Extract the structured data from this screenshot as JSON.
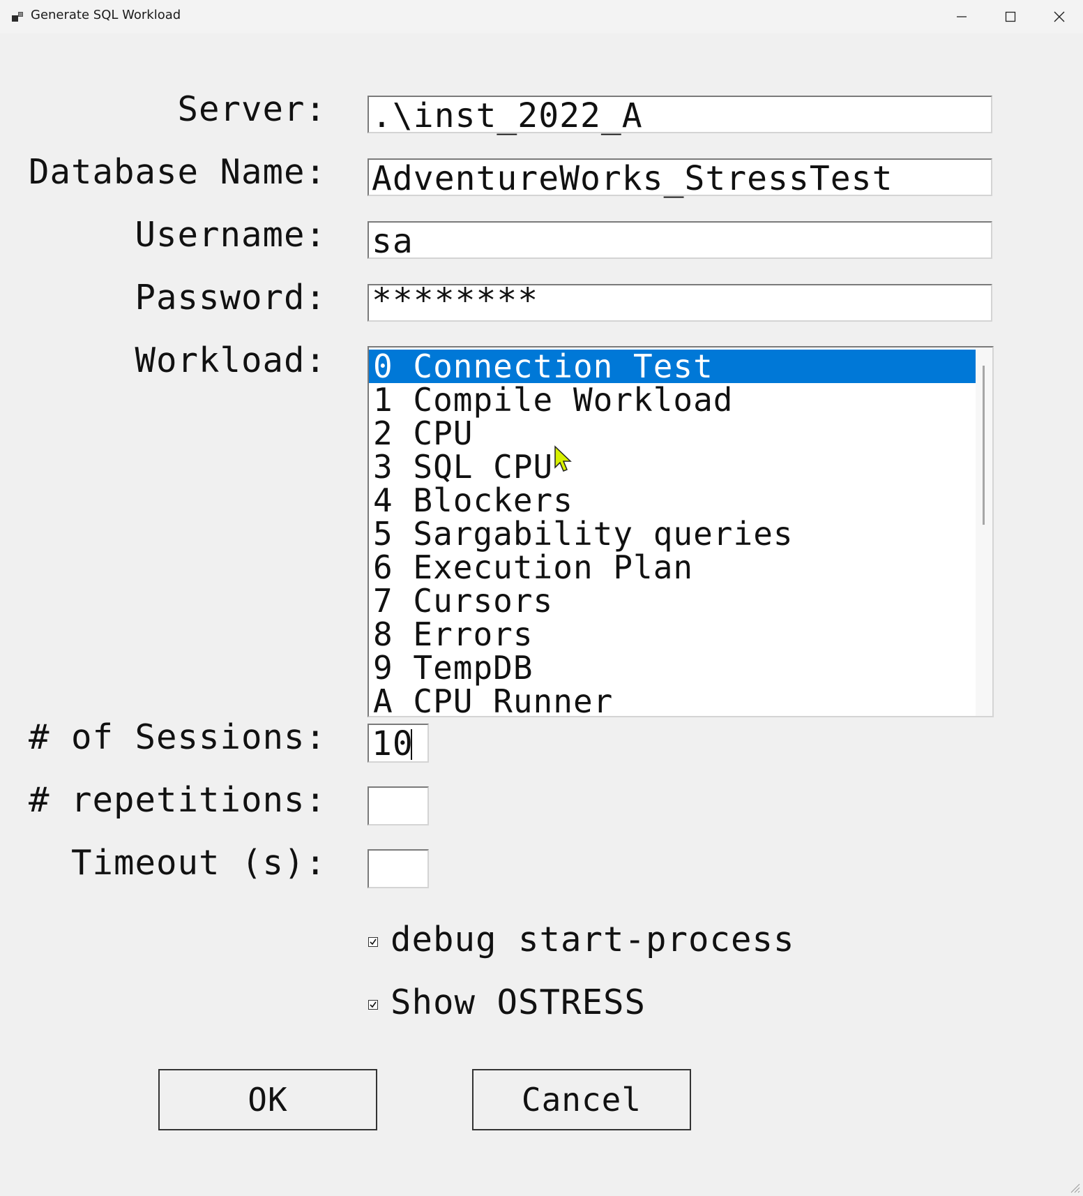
{
  "window": {
    "title": "Generate SQL Workload",
    "app_icon": "app-window-icon",
    "controls": [
      "minimize-icon",
      "maximize-icon",
      "close-icon"
    ]
  },
  "form": {
    "server": {
      "label": "Server:",
      "value": ".\\inst_2022_A"
    },
    "database": {
      "label": "Database Name:",
      "value": "AdventureWorks_StressTest"
    },
    "username": {
      "label": "Username:",
      "value": "sa"
    },
    "password": {
      "label": "Password:",
      "value": "********"
    },
    "workload": {
      "label": "Workload:",
      "selected_index": 0,
      "items": [
        "0 Connection Test",
        "1 Compile Workload",
        "2 CPU",
        "3 SQL CPU",
        "4 Blockers",
        "5 Sargability queries",
        "6 Execution Plan",
        "7 Cursors",
        "8 Errors",
        "9 TempDB",
        "A CPU Runner"
      ]
    },
    "sessions": {
      "label": "# of Sessions:",
      "value": "10"
    },
    "repetitions": {
      "label": "# repetitions:",
      "value": ""
    },
    "timeout": {
      "label": "Timeout (s):",
      "value": ""
    },
    "debug_checkbox": {
      "label": "debug start-process",
      "checked": true
    },
    "ostress_checkbox": {
      "label": "Show OSTRESS",
      "checked": true
    }
  },
  "buttons": {
    "ok": "OK",
    "cancel": "Cancel"
  },
  "colors": {
    "selection": "#0078d7",
    "background": "#f0f0f0"
  }
}
